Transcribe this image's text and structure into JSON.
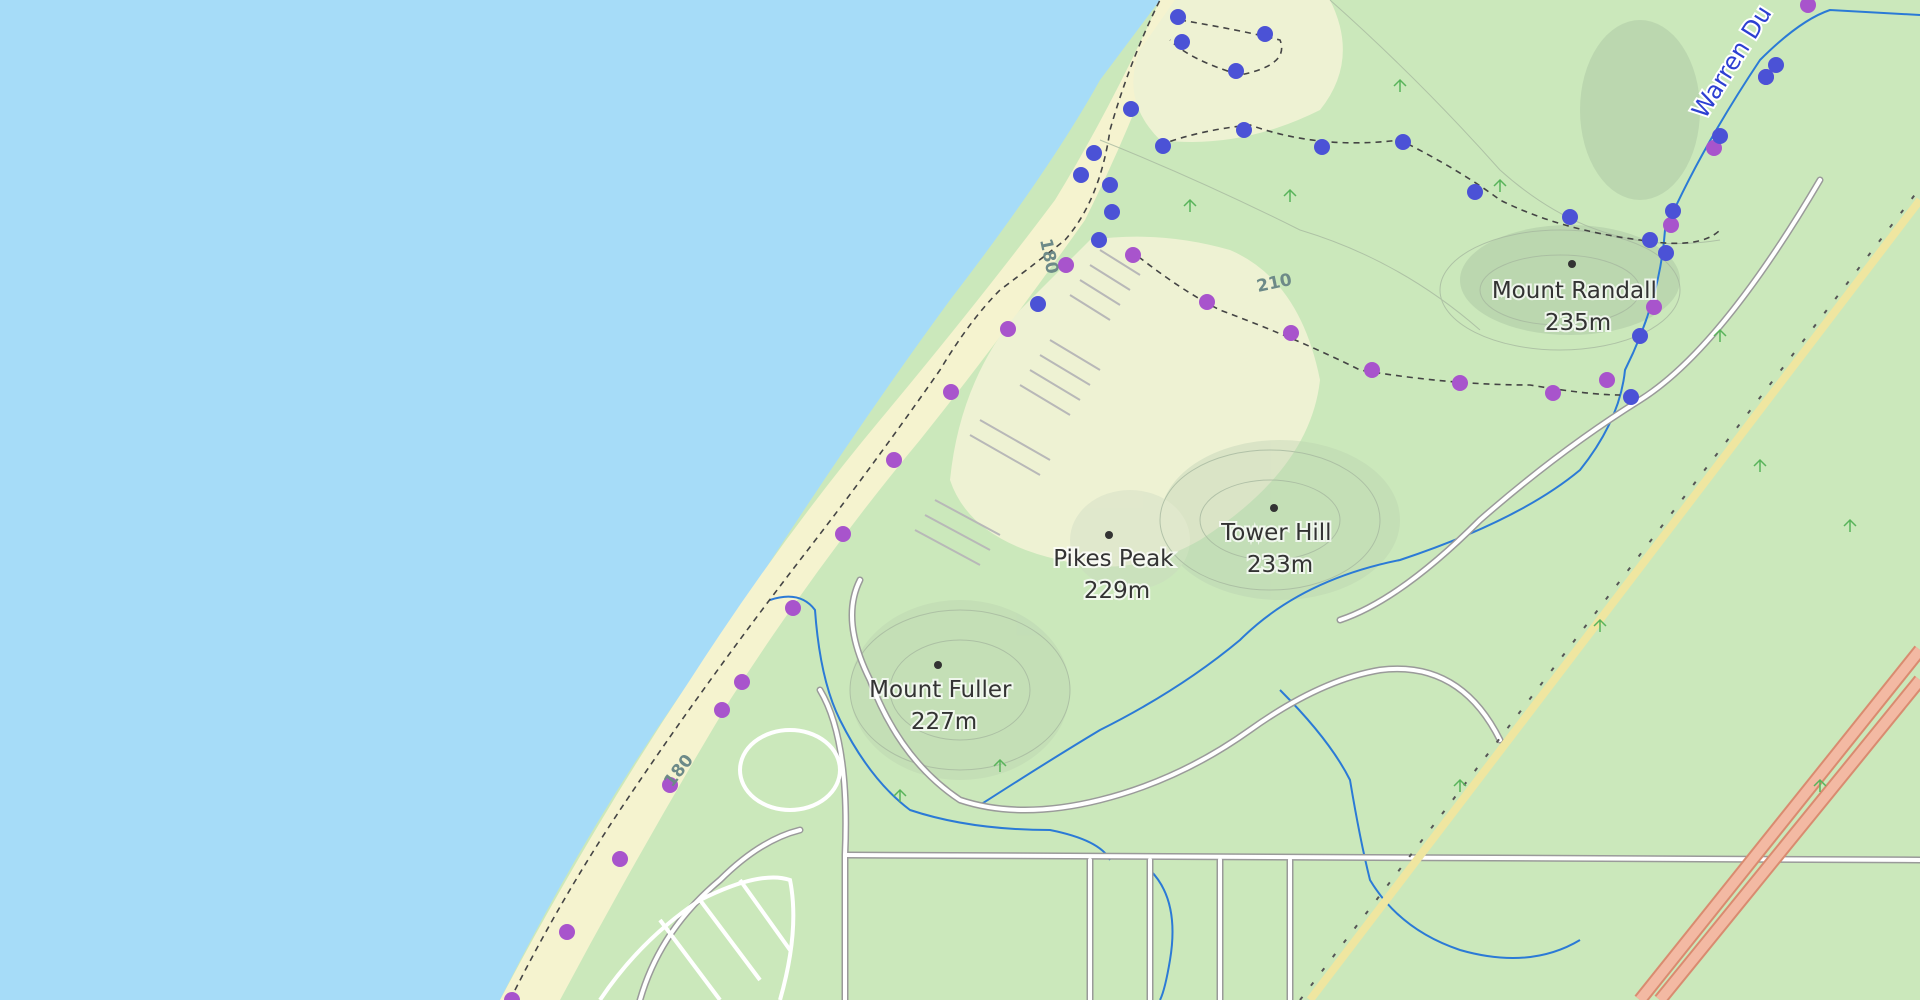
{
  "map": {
    "colors": {
      "water": "#a6dcf8",
      "beach": "#f5f3cf",
      "forest": "#cbe8bb",
      "meadow": "#eef2d3",
      "road": "#ffffff",
      "road_casing": "#9a9a9a",
      "stream": "#2b7ad6",
      "railway": "#555555",
      "highway": "#e69a7f",
      "trail_purple": "#a854cc",
      "trail_blue": "#4b52d6"
    },
    "peaks": [
      {
        "name": "Mount Randall",
        "elevation": "235m"
      },
      {
        "name": "Tower Hill",
        "elevation": "233m"
      },
      {
        "name": "Pikes Peak",
        "elevation": "229m"
      },
      {
        "name": "Mount Fuller",
        "elevation": "227m"
      }
    ],
    "contour_labels": [
      "180",
      "210",
      "180"
    ],
    "waterway_label": "Warren Du",
    "trails": [
      {
        "name": "purple-route",
        "color": "#a854cc"
      },
      {
        "name": "blue-route",
        "color": "#4b52d6"
      }
    ]
  }
}
